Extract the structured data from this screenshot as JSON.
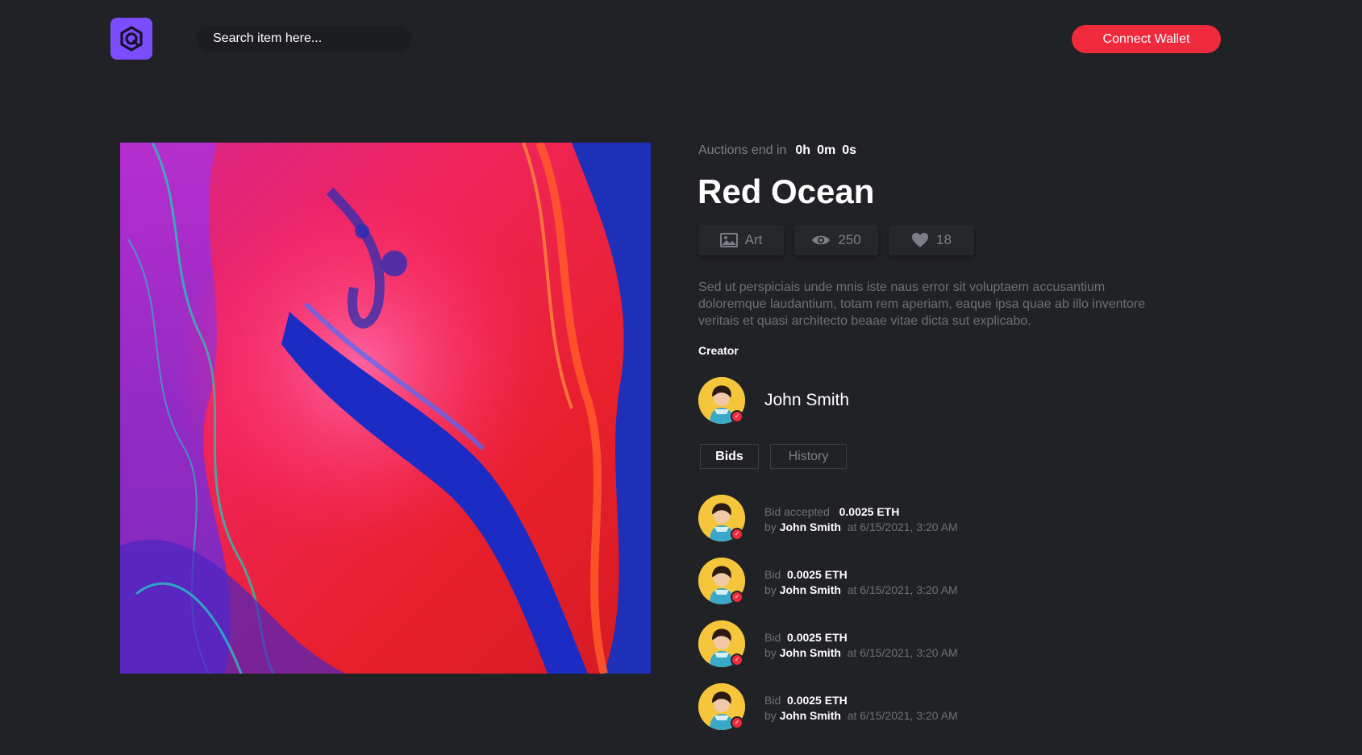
{
  "header": {
    "search_placeholder": "Search item here...",
    "connect_label": "Connect Wallet"
  },
  "colors": {
    "accent": "#ee2a3c",
    "logo": "#7b4dff",
    "background": "#202225"
  },
  "auction": {
    "label": "Auctions end in",
    "hours": "0h",
    "minutes": "0m",
    "seconds": "0s"
  },
  "item": {
    "title": "Red Ocean",
    "category": "Art",
    "views": "250",
    "likes": "18",
    "description": "Sed ut perspiciais unde mnis iste naus error sit voluptaem accusantium doloremque laudantium, totam rem aperiam, eaque ipsa quae ab illo inventore veritais et quasi architecto beaae vitae dicta sut explicabo."
  },
  "creator": {
    "label": "Creator",
    "name": "John Smith"
  },
  "tabs": [
    {
      "label": "Bids",
      "active": true
    },
    {
      "label": "History",
      "active": false
    }
  ],
  "bids": [
    {
      "type": "Bid accepted",
      "amount": "0.0025 ETH",
      "by": "by",
      "user": "John Smith",
      "at": "at 6/15/2021, 3:20 AM"
    },
    {
      "type": "Bid",
      "amount": "0.0025 ETH",
      "by": "by",
      "user": "John Smith",
      "at": "at 6/15/2021, 3:20 AM"
    },
    {
      "type": "Bid",
      "amount": "0.0025 ETH",
      "by": "by",
      "user": "John Smith",
      "at": "at 6/15/2021, 3:20 AM"
    },
    {
      "type": "Bid",
      "amount": "0.0025 ETH",
      "by": "by",
      "user": "John Smith",
      "at": "at 6/15/2021, 3:20 AM"
    }
  ]
}
